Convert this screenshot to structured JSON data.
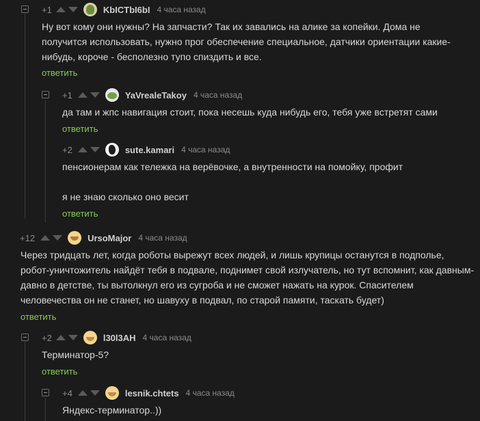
{
  "reply_label": "ответить",
  "comments": [
    {
      "rating": "+1",
      "author": "KbICTbI6bI",
      "time": "4 часа назад",
      "text": "Ну вот кому они нужны? На запчасти? Так их завались на алике за копейки. Дома не получится использовать, нужно прог обеспечение специальное, датчики ориентации какие-нибудь, короче - бесполезно тупо спиздить и все."
    },
    {
      "rating": "+1",
      "author": "YaVrealeTakoy",
      "time": "4 часа назад",
      "text": "да там и жпс навигация стоит, пока несешь куда нибудь его, тебя уже встретят сами"
    },
    {
      "rating": "+2",
      "author": "sute.kamari",
      "time": "4 часа назад",
      "text": "пенсионерам как тележка на верёвочке, а внутренности на помойку, профит",
      "text2": "я не знаю сколько оно весит"
    },
    {
      "rating": "+12",
      "author": "UrsoMajor",
      "time": "4 часа назад",
      "text": "Через тридцать лет, когда роботы вырежут всех людей, и лишь крупицы останутся в подполье, робот-уничтожитель найдёт тебя в подвале, поднимет свой излучатель, но тут вспомнит, как давным-давно в детстве, ты вытолкнул его из сугроба и не сможет нажать на курок. Спасителем человечества он не станет, но шавуху в подвал, по старой памяти, таскать будет)"
    },
    {
      "rating": "+2",
      "author": "l30l3AH",
      "time": "4 часа назад",
      "text": "Терминатор-5?"
    },
    {
      "rating": "+4",
      "author": "lesnik.chtets",
      "time": "4 часа назад",
      "text": "Яндекс-терминатор..))"
    }
  ]
}
